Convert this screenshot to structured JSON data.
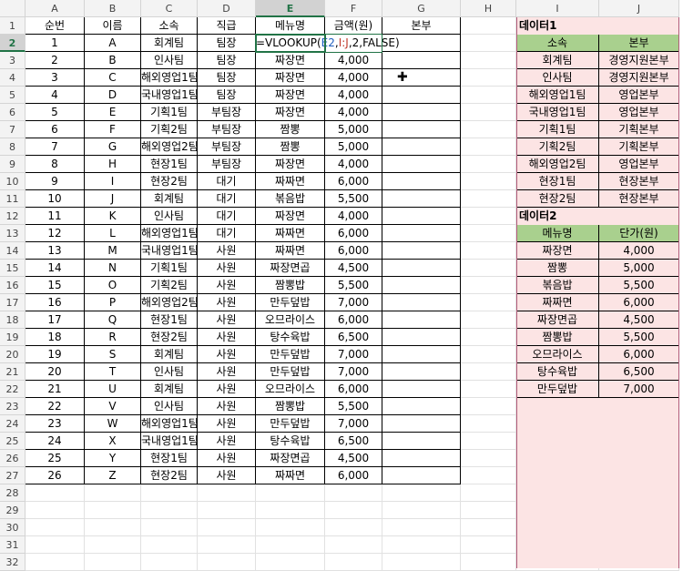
{
  "columns": [
    "A",
    "B",
    "C",
    "D",
    "E",
    "F",
    "G",
    "H",
    "I",
    "J"
  ],
  "row_numbers": [
    "1",
    "2",
    "3",
    "4",
    "5",
    "6",
    "7",
    "8",
    "9",
    "10",
    "11",
    "12",
    "13",
    "14",
    "15",
    "16",
    "17",
    "18",
    "19",
    "20",
    "21",
    "22",
    "23",
    "24",
    "25",
    "26",
    "27",
    "28",
    "29",
    "30",
    "31",
    "32"
  ],
  "main_headers": [
    "순번",
    "이름",
    "소속",
    "직급",
    "메뉴명",
    "금액(원)",
    "본부"
  ],
  "main_rows": [
    [
      "1",
      "A",
      "회계팀",
      "팀장",
      "",
      "",
      ""
    ],
    [
      "2",
      "B",
      "인사팀",
      "팀장",
      "짜장면",
      "4,000",
      ""
    ],
    [
      "3",
      "C",
      "해외영업1팀",
      "팀장",
      "짜장면",
      "4,000",
      ""
    ],
    [
      "4",
      "D",
      "국내영업1팀",
      "팀장",
      "짜장면",
      "4,000",
      ""
    ],
    [
      "5",
      "E",
      "기획1팀",
      "부팀장",
      "짜장면",
      "4,000",
      ""
    ],
    [
      "6",
      "F",
      "기획2팀",
      "부팀장",
      "짬뽕",
      "5,000",
      ""
    ],
    [
      "7",
      "G",
      "해외영업2팀",
      "부팀장",
      "짬뽕",
      "5,000",
      ""
    ],
    [
      "8",
      "H",
      "현장1팀",
      "부팀장",
      "짜장면",
      "4,000",
      ""
    ],
    [
      "9",
      "I",
      "현장2팀",
      "대기",
      "짜짜면",
      "6,000",
      ""
    ],
    [
      "10",
      "J",
      "회계팀",
      "대기",
      "볶음밥",
      "5,500",
      ""
    ],
    [
      "11",
      "K",
      "인사팀",
      "대기",
      "짜장면",
      "4,000",
      ""
    ],
    [
      "12",
      "L",
      "해외영업1팀",
      "대기",
      "짜짜면",
      "6,000",
      ""
    ],
    [
      "13",
      "M",
      "국내영업1팀",
      "사원",
      "짜짜면",
      "6,000",
      ""
    ],
    [
      "14",
      "N",
      "기획1팀",
      "사원",
      "짜장면곱",
      "4,500",
      ""
    ],
    [
      "15",
      "O",
      "기획2팀",
      "사원",
      "짬뽕밥",
      "5,500",
      ""
    ],
    [
      "16",
      "P",
      "해외영업2팀",
      "사원",
      "만두덮밥",
      "7,000",
      ""
    ],
    [
      "17",
      "Q",
      "현장1팀",
      "사원",
      "오므라이스",
      "6,000",
      ""
    ],
    [
      "18",
      "R",
      "현장2팀",
      "사원",
      "탕수육밥",
      "6,500",
      ""
    ],
    [
      "19",
      "S",
      "회계팀",
      "사원",
      "만두덮밥",
      "7,000",
      ""
    ],
    [
      "20",
      "T",
      "인사팀",
      "사원",
      "만두덮밥",
      "7,000",
      ""
    ],
    [
      "21",
      "U",
      "회계팀",
      "사원",
      "오므라이스",
      "6,000",
      ""
    ],
    [
      "22",
      "V",
      "인사팀",
      "사원",
      "짬뽕밥",
      "5,500",
      ""
    ],
    [
      "23",
      "W",
      "해외영업1팀",
      "사원",
      "만두덮밥",
      "7,000",
      ""
    ],
    [
      "24",
      "X",
      "국내영업1팀",
      "사원",
      "탕수육밥",
      "6,500",
      ""
    ],
    [
      "25",
      "Y",
      "현장1팀",
      "사원",
      "짜장면곱",
      "4,500",
      ""
    ],
    [
      "26",
      "Z",
      "현장2팀",
      "사원",
      "짜짜면",
      "6,000",
      ""
    ]
  ],
  "formula": {
    "prefix": "=VLOOKUP(",
    "ref_e": "E2",
    "sep1": ",",
    "ref_ij": "I:J",
    "suffix": ",2,FALSE)"
  },
  "data1": {
    "title": "데이터1",
    "headers": [
      "소속",
      "본부"
    ],
    "rows": [
      [
        "회계팀",
        "경영지원본부"
      ],
      [
        "인사팀",
        "경영지원본부"
      ],
      [
        "해외영업1팀",
        "영업본부"
      ],
      [
        "국내영업1팀",
        "영업본부"
      ],
      [
        "기획1팀",
        "기획본부"
      ],
      [
        "기획2팀",
        "기획본부"
      ],
      [
        "해외영업2팀",
        "영업본부"
      ],
      [
        "현장1팀",
        "현장본부"
      ],
      [
        "현장2팀",
        "현장본부"
      ]
    ]
  },
  "data2": {
    "title": "데이터2",
    "headers": [
      "메뉴명",
      "단가(원)"
    ],
    "rows": [
      [
        "짜장면",
        "4,000"
      ],
      [
        "짬뽕",
        "5,000"
      ],
      [
        "볶음밥",
        "5,500"
      ],
      [
        "짜짜면",
        "6,000"
      ],
      [
        "짜장면곱",
        "4,500"
      ],
      [
        "짬뽕밥",
        "5,500"
      ],
      [
        "오므라이스",
        "6,000"
      ],
      [
        "탕수육밥",
        "6,500"
      ],
      [
        "만두덮밥",
        "7,000"
      ]
    ]
  },
  "colors": {
    "selection": "#217346",
    "table_fill": "#fce4e4",
    "header_fill": "#a9d08e"
  }
}
